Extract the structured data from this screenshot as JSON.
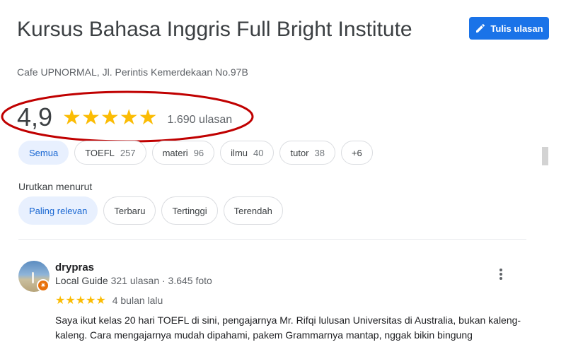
{
  "place": {
    "title": "Kursus Bahasa Inggris Full Bright Institute",
    "address": "Cafe UPNORMAL, Jl. Perintis Kemerdekaan No.97B"
  },
  "write_review_label": "Tulis ulasan",
  "summary": {
    "rating": "4,9",
    "stars": "★★★★★",
    "count": "1.690 ulasan",
    "highlight_color": "#c00000"
  },
  "topics": [
    {
      "label": "Semua",
      "count": ""
    },
    {
      "label": "TOEFL",
      "count": "257"
    },
    {
      "label": "materi",
      "count": "96"
    },
    {
      "label": "ilmu",
      "count": "40"
    },
    {
      "label": "tutor",
      "count": "38"
    },
    {
      "label": "+6",
      "count": ""
    }
  ],
  "sort": {
    "label": "Urutkan menurut",
    "options": [
      "Paling relevan",
      "Terbaru",
      "Tertinggi",
      "Terendah"
    ]
  },
  "review": {
    "author": "drypras",
    "badge_icon": "local-guide-star-icon",
    "guide": "Local Guide",
    "stats": "321 ulasan · 3.645 foto",
    "stars": "★★★★★",
    "time": "4 bulan lalu",
    "text": "Saya ikut kelas 20 hari TOEFL di sini, pengajarnya Mr. Rifqi lulusan Universitas di Australia, bukan kaleng-kaleng. Cara mengajarnya mudah dipahami, pakem Grammarnya mantap, nggak bikin bingung"
  },
  "colors": {
    "accent": "#1a73e8",
    "star": "#fbbc04",
    "chip_active_bg": "#e8f0fe"
  }
}
